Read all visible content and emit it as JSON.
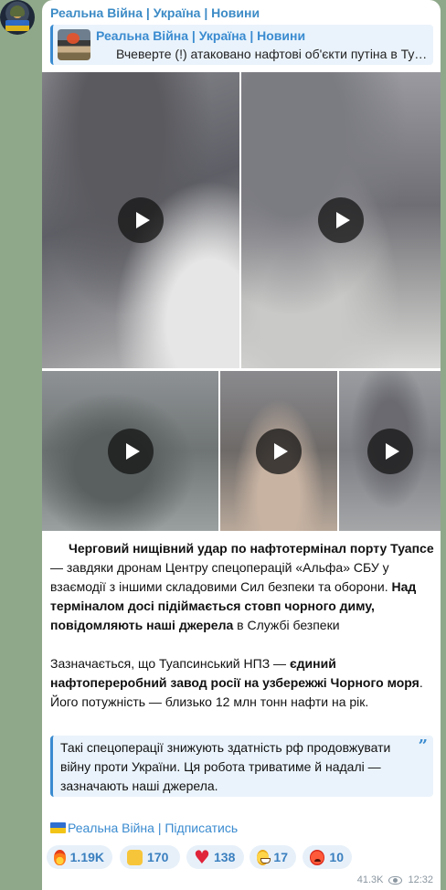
{
  "channel": {
    "name": "Реальна Війна | Україна | Новини"
  },
  "reply": {
    "title": "Реальна Війна | Україна | Новини",
    "text": "Вчеверте (!) атаковано нафтові об'єкти путіна в Туапсе"
  },
  "media": [
    {
      "type": "video",
      "icon": "play-icon"
    },
    {
      "type": "video",
      "icon": "play-icon"
    },
    {
      "type": "video",
      "icon": "play-icon"
    },
    {
      "type": "video",
      "icon": "play-icon"
    },
    {
      "type": "video",
      "icon": "play-icon"
    }
  ],
  "post": {
    "p1_bold1": "Черговий нищівний удар по нафтотермінал порту Туапсе",
    "p1_text1": " — завдяки дронам Центру спецоперацій «Альфа» СБУ у взаємодії з іншими складовими Сил безпеки та оборони. ",
    "p1_bold2": "Над терміналом досі підіймається стовп чорного диму, повідомляють наші джерела",
    "p1_text2": " в Службі безпеки",
    "p2_text1": "Зазначається, що Туапсинський НПЗ — ",
    "p2_bold1": "єдиний нафтопереробний завод росії на узбережжі Чорного моря",
    "p2_text2": ". Його потужність — близько 12 млн тонн нафти на рік."
  },
  "quote": {
    "text": "Такі спецоперації знижують здатність рф продовжувати війну проти України. Ця робота триватиме й надалі — зазначають наші джерела.",
    "icon": "quote-icon"
  },
  "footer": {
    "flag": "ukraine-flag",
    "subscribe": "Реальна Війна | Підписатись"
  },
  "reactions": [
    {
      "emoji": "fire",
      "count": "1.19K"
    },
    {
      "emoji": "thumbs-up",
      "count": "170"
    },
    {
      "emoji": "heart",
      "count": "138"
    },
    {
      "emoji": "grin",
      "count": "17"
    },
    {
      "emoji": "angry",
      "count": "10"
    }
  ],
  "meta": {
    "views": "41.3K",
    "time": "12:32"
  },
  "colors": {
    "accent": "#3a8bd0",
    "background": "#8fa88a"
  }
}
